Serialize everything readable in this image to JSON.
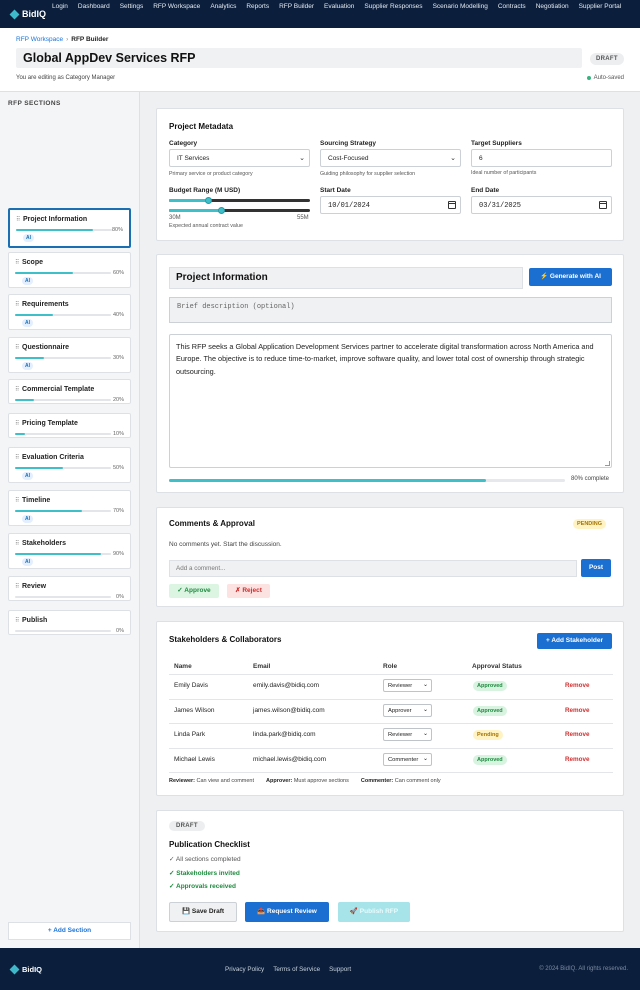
{
  "app": {
    "brand": "BidIQ"
  },
  "nav": [
    "Login",
    "Dashboard",
    "Settings",
    "RFP Workspace",
    "Analytics",
    "Reports",
    "RFP Builder",
    "Evaluation",
    "Supplier Responses",
    "Scenario Modelling",
    "Contracts",
    "Negotiation",
    "Supplier Portal"
  ],
  "header": {
    "breadcrumb_parent": "RFP Workspace",
    "breadcrumb_sep": "›",
    "breadcrumb_current": "RFP Builder",
    "title": "Global AppDev Services RFP",
    "status": "DRAFT",
    "editing_note": "You are editing as Category Manager",
    "autosave": "Auto-saved"
  },
  "sidebar": {
    "title": "RFP SECTIONS",
    "sections": [
      {
        "name": "Project Information",
        "percent": "80%",
        "progress": 0.8,
        "ai": "AI"
      },
      {
        "name": "Scope",
        "percent": "60%",
        "progress": 0.6,
        "ai": "AI"
      },
      {
        "name": "Requirements",
        "percent": "40%",
        "progress": 0.4,
        "ai": "AI"
      },
      {
        "name": "Questionnaire",
        "percent": "30%",
        "progress": 0.3,
        "ai": "AI"
      },
      {
        "name": "Commercial Template",
        "percent": "20%",
        "progress": 0.2,
        "ai": ""
      },
      {
        "name": "Pricing Template",
        "percent": "10%",
        "progress": 0.1,
        "ai": ""
      },
      {
        "name": "Evaluation Criteria",
        "percent": "50%",
        "progress": 0.5,
        "ai": "AI"
      },
      {
        "name": "Timeline",
        "percent": "70%",
        "progress": 0.7,
        "ai": "AI"
      },
      {
        "name": "Stakeholders",
        "percent": "90%",
        "progress": 0.9,
        "ai": "AI"
      },
      {
        "name": "Review",
        "percent": "0%",
        "progress": 0.0,
        "ai": ""
      },
      {
        "name": "Publish",
        "percent": "0%",
        "progress": 0.0,
        "ai": ""
      }
    ],
    "add_label": "+ Add Section",
    "grip": "⠿"
  },
  "metadata": {
    "title": "Project Metadata",
    "category_label": "Category",
    "category_value": "IT Services",
    "category_hint": "Primary service or product category",
    "strategy_label": "Sourcing Strategy",
    "strategy_value": "Cost-Focused",
    "strategy_hint": "Guiding philosophy for supplier selection",
    "suppliers_label": "Target Suppliers",
    "suppliers_value": "6",
    "suppliers_hint": "Ideal number of participants",
    "budget_label": "Budget Range (M USD)",
    "budget_min": "30M",
    "budget_max": "55M",
    "budget_low_fraction": 0.28,
    "budget_high_fraction": 0.37,
    "budget_hint": "Expected annual contract value",
    "start_label": "Start Date",
    "start_value": "10/01/2024",
    "end_label": "End Date",
    "end_value": "03/31/2025"
  },
  "editor": {
    "section_title": "Project Information",
    "generate_label": "⚡ Generate with AI",
    "description_placeholder": "Brief description (optional)",
    "body": "This RFP seeks a Global Application Development Services partner to accelerate digital transformation across North America and Europe. The objective is to reduce time-to-market, improve software quality, and lower total cost of ownership through strategic outsourcing.",
    "progress": 0.8,
    "progress_label": "80% complete"
  },
  "comments": {
    "title": "Comments & Approval",
    "status": "PENDING",
    "empty": "No comments yet. Start the discussion.",
    "input_placeholder": "Add a comment...",
    "post_label": "Post",
    "approve_label": "✓ Approve",
    "reject_label": "✗ Reject"
  },
  "stakeholders": {
    "title": "Stakeholders & Collaborators",
    "add_label": "+ Add Stakeholder",
    "columns": [
      "Name",
      "Email",
      "Role",
      "Approval Status"
    ],
    "rows": [
      {
        "name": "Emily Davis",
        "email": "emily.davis@bidiq.com",
        "role": "Reviewer",
        "status": "Approved",
        "remove": "Remove"
      },
      {
        "name": "James Wilson",
        "email": "james.wilson@bidiq.com",
        "role": "Approver",
        "status": "Approved",
        "remove": "Remove"
      },
      {
        "name": "Linda Park",
        "email": "linda.park@bidiq.com",
        "role": "Reviewer",
        "status": "Pending",
        "remove": "Remove"
      },
      {
        "name": "Michael Lewis",
        "email": "michael.lewis@bidiq.com",
        "role": "Commenter",
        "status": "Approved",
        "remove": "Remove"
      }
    ],
    "legend": [
      {
        "term": "Reviewer:",
        "desc": "Can view and comment"
      },
      {
        "term": "Approver:",
        "desc": "Must approve sections"
      },
      {
        "term": "Commenter:",
        "desc": "Can comment only"
      }
    ]
  },
  "publication": {
    "status": "DRAFT",
    "title": "Publication Checklist",
    "checks": [
      {
        "text": "✓ All sections completed",
        "done": false
      },
      {
        "text": "✓ Stakeholders invited",
        "done": true
      },
      {
        "text": "✓ Approvals received",
        "done": true
      }
    ],
    "save_label": "💾 Save Draft",
    "review_label": "📤 Request Review",
    "publish_label": "🚀 Publish RFP"
  },
  "footer": {
    "brand": "BidIQ",
    "links": [
      "Privacy Policy",
      "Terms of Service",
      "Support"
    ],
    "copyright": "© 2024 BidIQ. All rights reserved."
  },
  "colors": {
    "navy": "#0b1f3d",
    "accent": "#3fbfc9",
    "primary": "#1a6fd0"
  }
}
